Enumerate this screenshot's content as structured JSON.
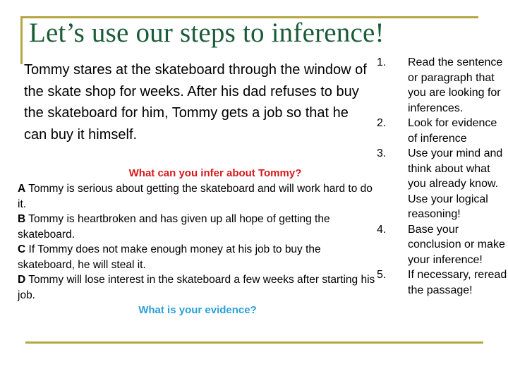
{
  "slide": {
    "title": "Let’s use our steps to inference!",
    "colors": {
      "title": "#1a5c38",
      "frame": "#b5a642",
      "question": "#d7191c",
      "evidence_prompt": "#2aa0d6"
    },
    "passage": "Tommy stares at the skateboard through the window of the skate shop for weeks. After his dad refuses to buy the skateboard for him, Tommy gets a job so that he can buy it himself.",
    "question": "What can you infer about Tommy?",
    "options": [
      {
        "letter": "A",
        "text": " Tommy is serious about getting the skateboard and will work hard to do it."
      },
      {
        "letter": "B",
        "text": " Tommy is heartbroken and has given up all hope of getting the skateboard."
      },
      {
        "letter": "C",
        "text": " If Tommy does not make enough money at his job to buy the skateboard, he will steal it."
      },
      {
        "letter": "D",
        "text": " Tommy will lose interest in the skateboard a few weeks after starting his job."
      }
    ],
    "evidence_prompt": "What is your evidence?",
    "steps": [
      {
        "number": "1.",
        "text": "Read the sentence or paragraph that you are looking for inferences."
      },
      {
        "number": "2.",
        "text": "Look for evidence of inference"
      },
      {
        "number": "3.",
        "text": "Use your mind and think about what you already know.  Use your logical reasoning!"
      },
      {
        "number": "4.",
        "text": "Base your conclusion or make your inference!"
      },
      {
        "number": "5.",
        "text": "If necessary, reread the passage!"
      }
    ]
  }
}
